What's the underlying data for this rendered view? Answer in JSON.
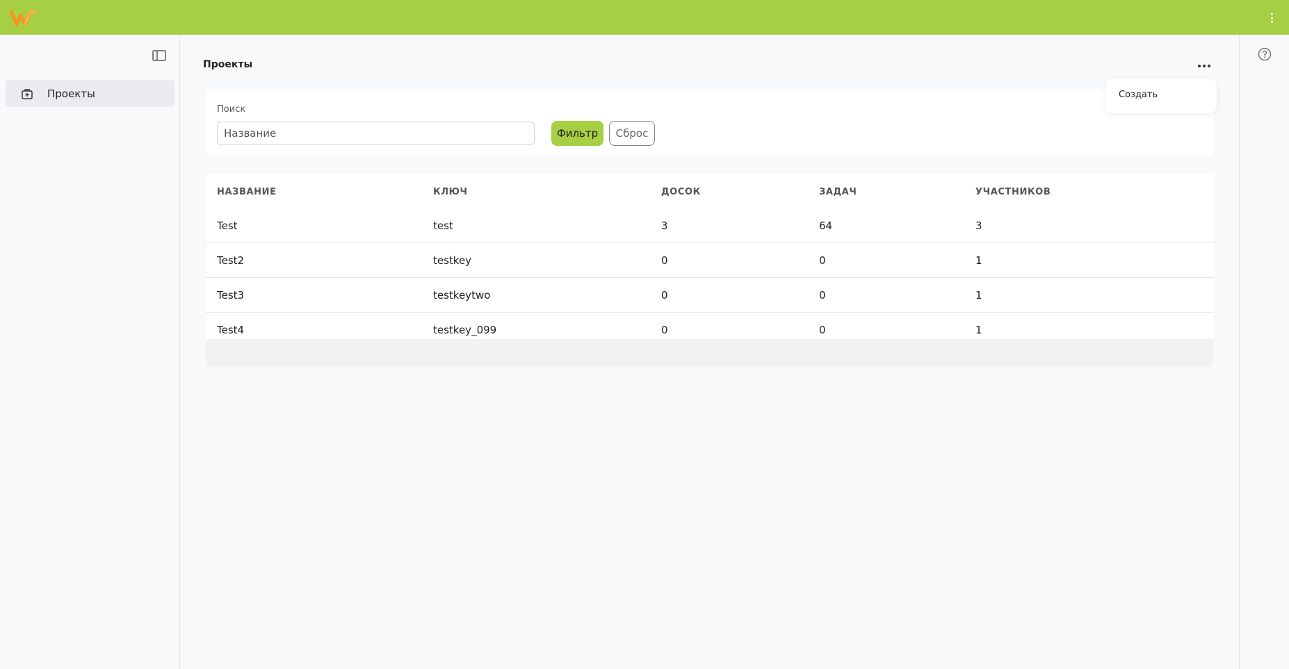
{
  "app": {
    "colors": {
      "accent": "#a6cf44",
      "logo": "#f7941d"
    }
  },
  "sidebar": {
    "items": [
      {
        "label": "Проекты",
        "icon": "briefcase-plus-icon",
        "active": true
      }
    ]
  },
  "page": {
    "title": "Проекты"
  },
  "dropdown": {
    "items": [
      {
        "label": "Создать"
      }
    ]
  },
  "filter": {
    "search_label": "Поиск",
    "search_placeholder": "Название",
    "search_value": "",
    "filter_label": "Фильтр",
    "reset_label": "Сброс"
  },
  "table": {
    "headers": [
      "НАЗВАНИЕ",
      "КЛЮЧ",
      "ДОСОК",
      "ЗАДАЧ",
      "УЧАСТНИКОВ"
    ],
    "rows": [
      [
        "Test",
        "test",
        "3",
        "64",
        "3"
      ],
      [
        "Test2",
        "testkey",
        "0",
        "0",
        "1"
      ],
      [
        "Test3",
        "testkeytwo",
        "0",
        "0",
        "1"
      ],
      [
        "Test4",
        "testkey_099",
        "0",
        "0",
        "1"
      ]
    ]
  }
}
